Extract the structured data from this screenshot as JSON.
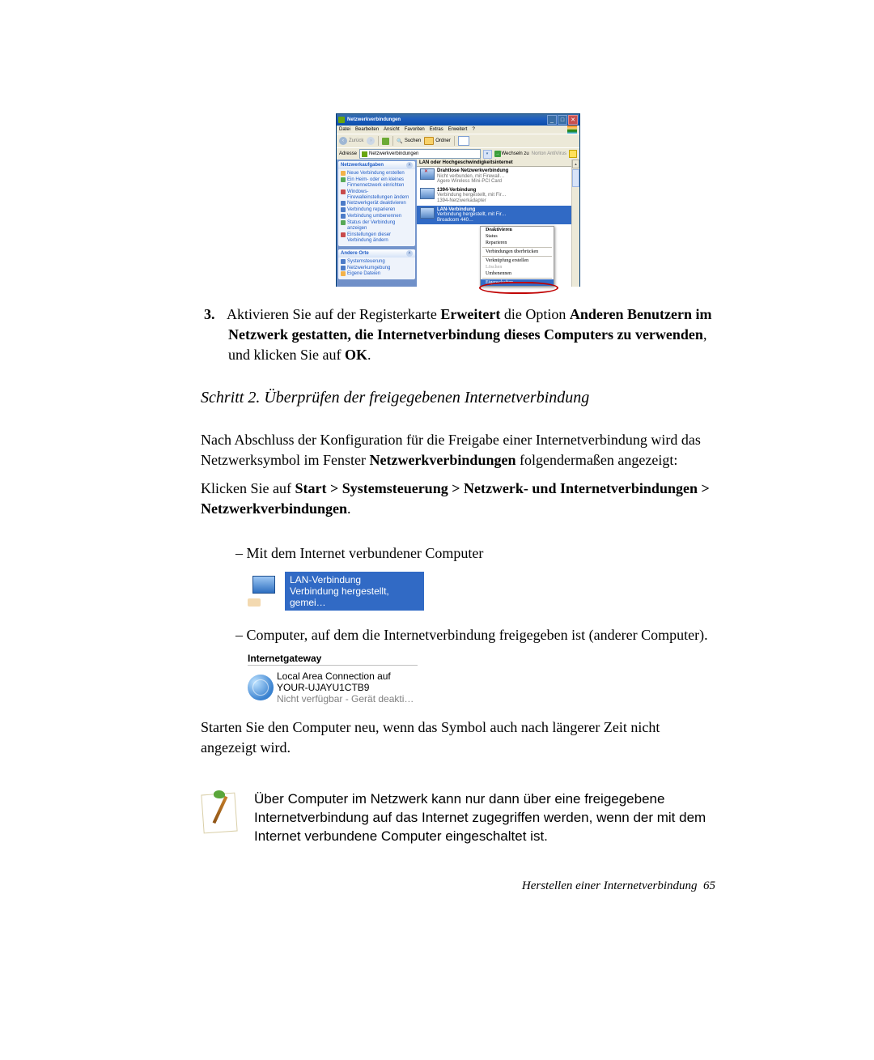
{
  "xp": {
    "title": "Netzwerkverbindungen",
    "menu": [
      "Datei",
      "Bearbeiten",
      "Ansicht",
      "Favoriten",
      "Extras",
      "Erweitert",
      "?"
    ],
    "toolbar": {
      "back": "Zurück",
      "search": "Suchen",
      "folders": "Ordner"
    },
    "address_label": "Adresse",
    "address_value": "Netzwerkverbindungen",
    "go_label": "Wechseln zu",
    "norton": "Norton AntiVirus",
    "tasks_panel": {
      "title": "Netzwerkaufgaben",
      "items": [
        "Neue Verbindung erstellen",
        "Ein Heim- oder ein kleines Firmennetzwerk einrichten",
        "Windows-Firewalleinstellungen ändern",
        "Netzwerkgerät deaktivieren",
        "Verbindung reparieren",
        "Verbindung umbenennen",
        "Status der Verbindung anzeigen",
        "Einstellungen dieser Verbindung ändern"
      ]
    },
    "other_panel": {
      "title": "Andere Orte",
      "items": [
        "Systemsteuerung",
        "Netzwerkumgebung",
        "Eigene Dateien"
      ]
    },
    "group_header": "LAN oder Hochgeschwindigkeitsinternet",
    "conns": [
      {
        "name": "Drahtlose Netzwerkverbindung",
        "line2": "Nicht verbunden, mit Firewall…",
        "line3": "Agere Wireless Mini-PCI Card"
      },
      {
        "name": "1394-Verbindung",
        "line2": "Verbindung hergestellt, mit Fir…",
        "line3": "1394-Netzwerkadapter"
      },
      {
        "name": "LAN-Verbindung",
        "line2": "Verbindung hergestellt, mit Fir…",
        "line3": "Broadcom 440…"
      }
    ],
    "context_menu": [
      "Deaktivieren",
      "Status",
      "Reparieren",
      "Verbindungen überbrücken",
      "Verknüpfung erstellen",
      "Löschen",
      "Umbenennen",
      "Eigenschaften"
    ]
  },
  "step3": {
    "num": "3.",
    "p1": "Aktivieren Sie auf der Registerkarte ",
    "b1": "Erweitert",
    "p2": " die Option ",
    "b2": "Anderen Benutzern im Netzwerk gestatten, die Internetverbindung dieses Computers zu verwenden",
    "p3": ", und klicken Sie auf ",
    "b3": "OK",
    "p4": "."
  },
  "heading": "Schritt 2. Überprüfen der freigegebenen Internetverbindung",
  "para1": {
    "a": "Nach Abschluss der Konfiguration für die Freigabe einer Internetverbindung wird das Netzwerksymbol im Fenster ",
    "b": "Netzwerkverbindungen",
    "c": " folgendermaßen angezeigt:"
  },
  "para2": {
    "a": "Klicken Sie auf ",
    "b": "Start > Systemsteuerung > Netzwerk- und Internetverbindungen > Netzwerkverbindungen",
    "c": "."
  },
  "bullet1": "Mit dem Internet verbundener Computer",
  "lan_icon": {
    "l1": "LAN-Verbindung",
    "l2": "Verbindung hergestellt, gemei…"
  },
  "bullet2": "Computer, auf dem die Internetverbindung freigegeben ist (anderer Computer).",
  "gateway_head": "Internetgateway",
  "gateway": {
    "l1": "Local Area Connection auf",
    "l2": "YOUR-UJAYU1CTB9",
    "l3": "Nicht verfügbar - Gerät deakti…"
  },
  "para3": "Starten Sie den Computer neu, wenn das Symbol auch nach längerer Zeit nicht angezeigt wird.",
  "note": "Über Computer im Netzwerk kann nur dann über eine freigegebene Internetverbindung auf das Internet zugegriffen werden, wenn der mit dem Internet verbundene Computer eingeschaltet ist.",
  "footer": {
    "text": "Herstellen einer Internetverbindung",
    "page": "65"
  }
}
